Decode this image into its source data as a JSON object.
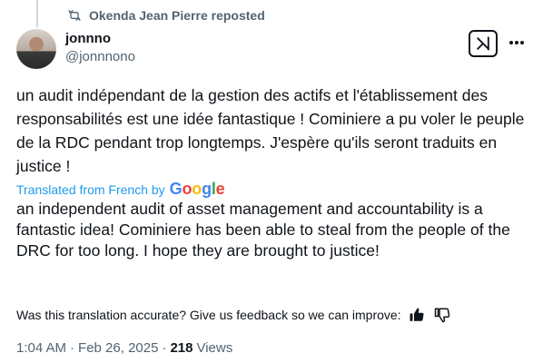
{
  "repost": {
    "label": "Okenda Jean Pierre reposted",
    "icon": "repost-icon"
  },
  "author": {
    "name": "jonnno",
    "handle": "@jonnnono"
  },
  "tweet": {
    "original_text": "un audit indépendant de la gestion des actifs et l'établissement des responsabilités est une idée fantastique ! Cominiere a pu voler le peuple de la RDC pendant trop longtemps. J'espère qu'ils seront traduits en justice !",
    "translated_label": "Translated from French by",
    "translated_text": "an independent audit of asset management and accountability is a fantastic idea! Cominiere has been able to steal from the people of the DRC for too long. I hope they are brought to justice!"
  },
  "feedback": {
    "question": "Was this translation accurate? Give us feedback so we can improve:"
  },
  "meta": {
    "time": "1:04 AM",
    "sep1": "·",
    "date": "Feb 26, 2025",
    "sep2": "·",
    "views_count": "218",
    "views_label": "Views"
  },
  "colors": {
    "link": "#1d9bf0",
    "secondary": "#536471",
    "primary": "#0f1419"
  },
  "google_logo": [
    "G",
    "o",
    "o",
    "g",
    "l",
    "e"
  ]
}
